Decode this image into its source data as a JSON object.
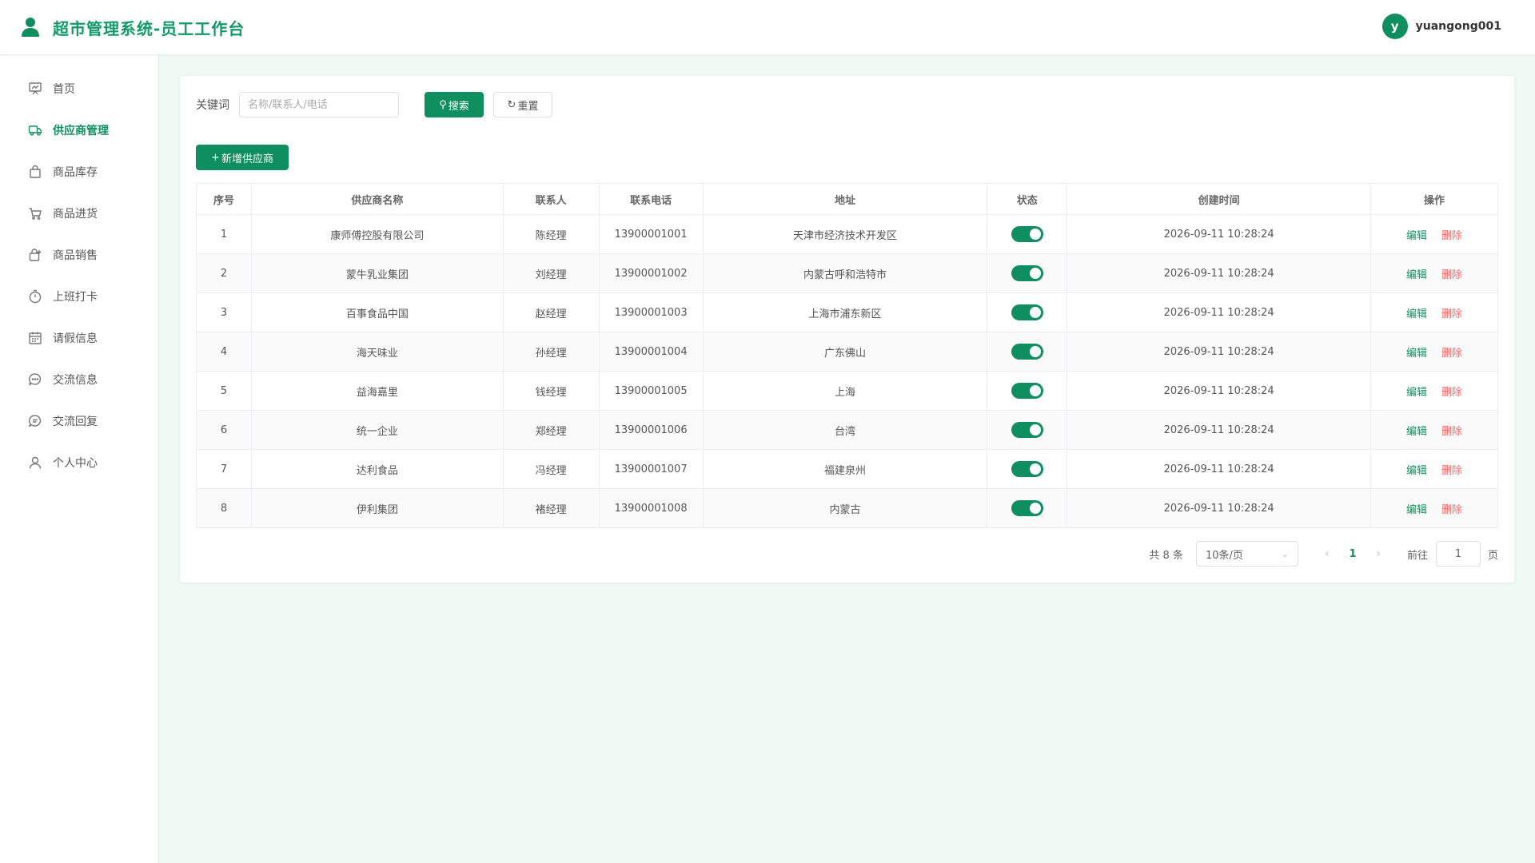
{
  "header": {
    "title": "超市管理系统-员工工作台",
    "user": {
      "avatar_letter": "y",
      "username": "yuangong001"
    }
  },
  "sidebar": {
    "items": [
      {
        "label": "首页",
        "icon": "dashboard-icon",
        "active": false
      },
      {
        "label": "供应商管理",
        "icon": "truck-icon",
        "active": true
      },
      {
        "label": "商品库存",
        "icon": "shopping-bag-icon",
        "active": false
      },
      {
        "label": "商品进货",
        "icon": "cart-icon",
        "active": false
      },
      {
        "label": "商品销售",
        "icon": "sell-icon",
        "active": false
      },
      {
        "label": "上班打卡",
        "icon": "stopwatch-icon",
        "active": false
      },
      {
        "label": "请假信息",
        "icon": "calendar-icon",
        "active": false
      },
      {
        "label": "交流信息",
        "icon": "chat-dots-icon",
        "active": false
      },
      {
        "label": "交流回复",
        "icon": "chat-lines-icon",
        "active": false
      },
      {
        "label": "个人中心",
        "icon": "user-icon",
        "active": false
      }
    ]
  },
  "filter": {
    "keyword_label": "关键词",
    "keyword_placeholder": "名称/联系人/电话",
    "keyword_value": "",
    "search_label": "搜索",
    "reset_label": "重置"
  },
  "actions": {
    "add_label": "新增供应商"
  },
  "table": {
    "columns": [
      "序号",
      "供应商名称",
      "联系人",
      "联系电话",
      "地址",
      "状态",
      "创建时间",
      "操作"
    ],
    "edit_label": "编辑",
    "delete_label": "删除",
    "rows": [
      {
        "index": "1",
        "name": "康师傅控股有限公司",
        "contact": "陈经理",
        "phone": "13900001001",
        "address": "天津市经济技术开发区",
        "enabled": true,
        "created": "2026-09-11 10:28:24"
      },
      {
        "index": "2",
        "name": "蒙牛乳业集团",
        "contact": "刘经理",
        "phone": "13900001002",
        "address": "内蒙古呼和浩特市",
        "enabled": true,
        "created": "2026-09-11 10:28:24"
      },
      {
        "index": "3",
        "name": "百事食品中国",
        "contact": "赵经理",
        "phone": "13900001003",
        "address": "上海市浦东新区",
        "enabled": true,
        "created": "2026-09-11 10:28:24"
      },
      {
        "index": "4",
        "name": "海天味业",
        "contact": "孙经理",
        "phone": "13900001004",
        "address": "广东佛山",
        "enabled": true,
        "created": "2026-09-11 10:28:24"
      },
      {
        "index": "5",
        "name": "益海嘉里",
        "contact": "钱经理",
        "phone": "13900001005",
        "address": "上海",
        "enabled": true,
        "created": "2026-09-11 10:28:24"
      },
      {
        "index": "6",
        "name": "统一企业",
        "contact": "郑经理",
        "phone": "13900001006",
        "address": "台湾",
        "enabled": true,
        "created": "2026-09-11 10:28:24"
      },
      {
        "index": "7",
        "name": "达利食品",
        "contact": "冯经理",
        "phone": "13900001007",
        "address": "福建泉州",
        "enabled": true,
        "created": "2026-09-11 10:28:24"
      },
      {
        "index": "8",
        "name": "伊利集团",
        "contact": "褚经理",
        "phone": "13900001008",
        "address": "内蒙古",
        "enabled": true,
        "created": "2026-09-11 10:28:24"
      }
    ]
  },
  "pagination": {
    "total_text": "共 8 条",
    "page_size": "10条/页",
    "current_page": "1",
    "goto_label": "前往",
    "goto_value": "1",
    "page_unit": "页"
  },
  "colors": {
    "primary": "#0f8f5f",
    "danger": "#f56c6c",
    "background": "#f0faf4"
  }
}
